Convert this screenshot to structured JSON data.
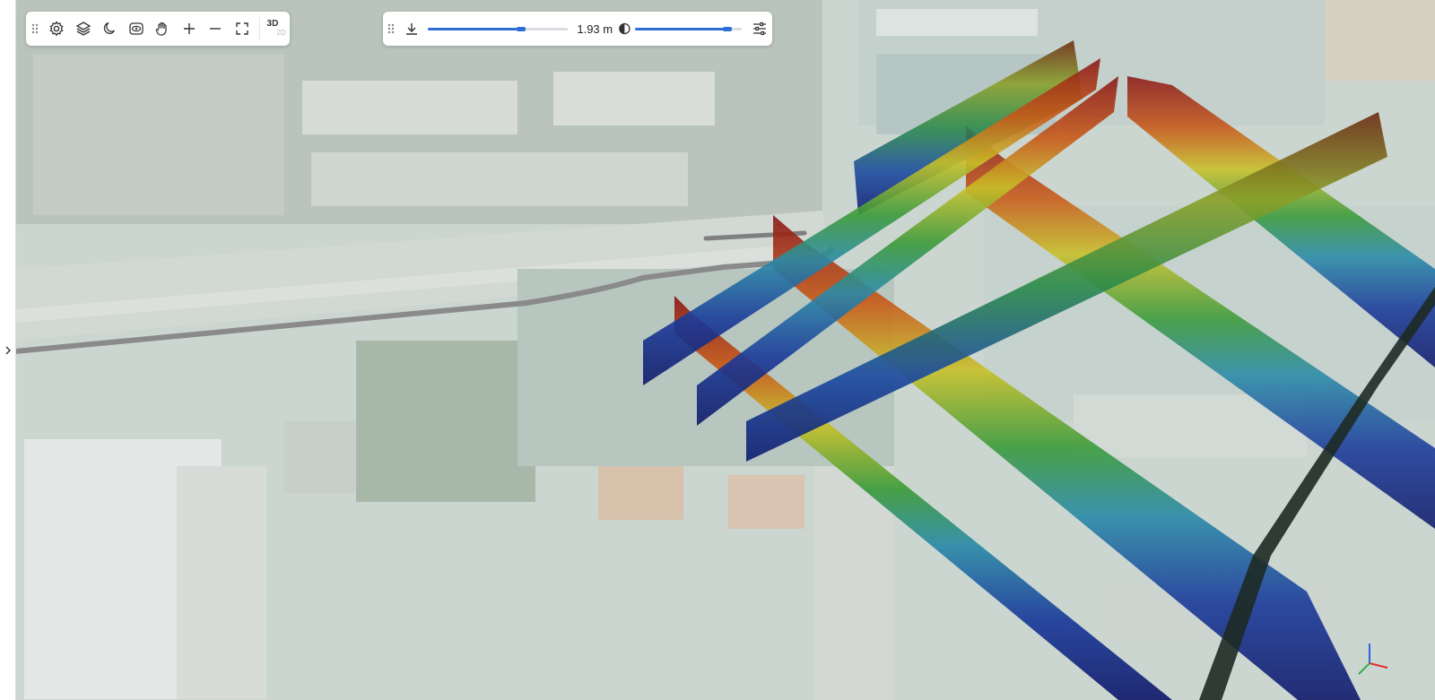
{
  "toolbar": {
    "mode_primary": "3D",
    "mode_secondary": "2D",
    "icons": [
      "drag-handle-icon",
      "settings-icon",
      "layers-icon",
      "night-mode-icon",
      "view-icon",
      "pan-hand-icon",
      "zoom-in-icon",
      "zoom-out-icon",
      "fullscreen-icon"
    ]
  },
  "measure_bar": {
    "depth_label": "1.93 m",
    "depth_fraction": 0.7,
    "opacity_fraction": 0.9,
    "icons": [
      "drag-handle-icon",
      "download-icon",
      "contrast-icon",
      "adjust-sliders-icon"
    ]
  },
  "colors": {
    "accent": "#2e6fd6",
    "pipe": "#8a8a8a",
    "axis_x": "#e03030",
    "axis_y": "#30b040",
    "axis_z": "#3060e0"
  }
}
